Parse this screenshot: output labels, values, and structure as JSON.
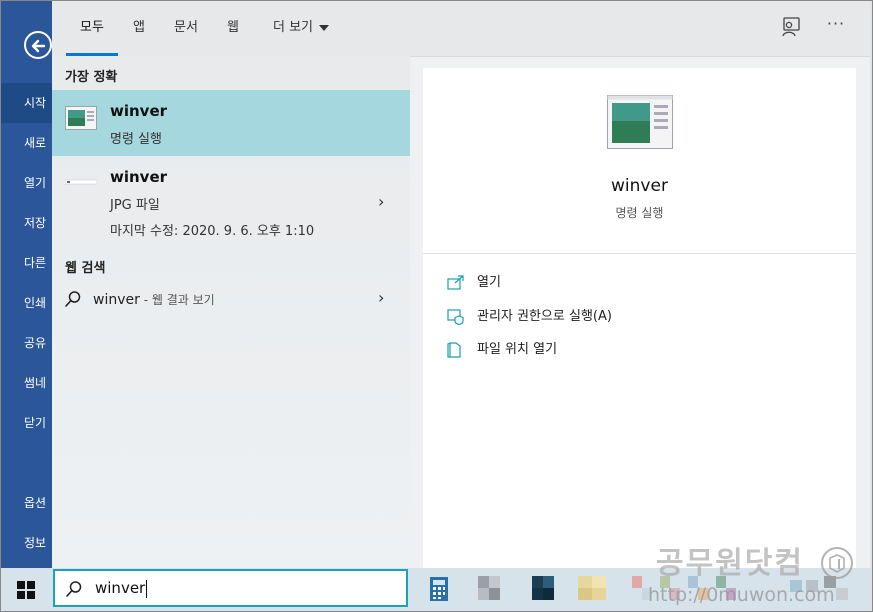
{
  "word_menu": {
    "items": [
      "시작",
      "새로",
      "열기",
      "저장",
      "다른",
      "인쇄",
      "공유",
      "썸네",
      "닫기"
    ],
    "bottom_items": [
      "옵션",
      "정보"
    ]
  },
  "tabs": {
    "all": "모두",
    "apps": "앱",
    "docs": "문서",
    "web": "웹",
    "more": "더 보기"
  },
  "toolbar": {
    "more_glyph": "···"
  },
  "results": {
    "best_match_heading": "가장 정확",
    "best": {
      "title": "winver",
      "subtitle": "명령 실행"
    },
    "second": {
      "title": "winver",
      "type": "JPG 파일",
      "modified": "마지막 수정: 2020. 9. 6. 오후 1:10"
    },
    "web_heading": "웹 검색",
    "web": {
      "query": "winver",
      "suffix": " - 웹 결과 보기"
    },
    "chevron": "›"
  },
  "detail": {
    "title": "winver",
    "subtitle": "명령 실행",
    "actions": {
      "open": "열기",
      "run_admin": "관리자 권한으로 실행(A)",
      "open_location": "파일 위치 열기"
    }
  },
  "taskbar": {
    "search_value": "winver"
  },
  "watermark": {
    "text": "공무원닷컴",
    "url": "http://0muwon.com"
  },
  "colors": {
    "word_blue": "#2b579a",
    "selection": "#a5d8de",
    "accent": "#0078d4",
    "search_border": "#1aa3b7"
  }
}
